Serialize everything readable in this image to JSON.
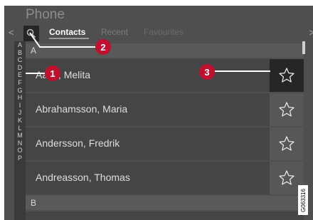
{
  "app": {
    "title": "Phone"
  },
  "nav": {
    "left_glyph": "<",
    "right_glyph": ">"
  },
  "tabs": [
    {
      "label": "Contacts",
      "active": true
    },
    {
      "label": "Recent",
      "active": false
    },
    {
      "label": "Favourites",
      "active": false
    }
  ],
  "alphabet": [
    "A",
    "B",
    "C",
    "D",
    "E",
    "F",
    "G",
    "H",
    "I",
    "J",
    "K",
    "L",
    "M",
    "N",
    "O",
    "P"
  ],
  "sections": [
    {
      "letter": "A",
      "contacts": [
        {
          "name": "Aalto, Melita",
          "favourite_selected": true
        },
        {
          "name": "Abrahamsson, Maria",
          "favourite_selected": false
        },
        {
          "name": "Andersson, Fredrik",
          "favourite_selected": false
        },
        {
          "name": "Andreasson, Thomas",
          "favourite_selected": false
        }
      ]
    },
    {
      "letter": "B",
      "contacts": []
    }
  ],
  "callouts": [
    "1",
    "2",
    "3"
  ],
  "image_id": "G063316",
  "icons": {
    "search": "search-icon",
    "favourite": "star-outline-icon"
  },
  "colors": {
    "callout": "#c0102e",
    "background": "#4f4f4f",
    "row": "#454545"
  }
}
